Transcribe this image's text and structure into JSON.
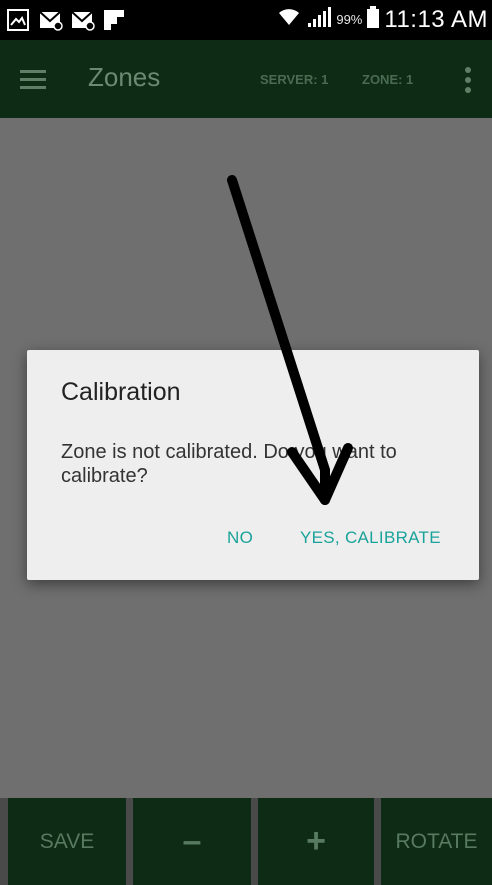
{
  "status_bar": {
    "icons_left": [
      "gallery-icon",
      "email-icon",
      "email-icon",
      "flipboard-icon"
    ],
    "icons_right": [
      "wifi-icon",
      "signal-icon",
      "battery-icon"
    ],
    "battery_percent": "99%",
    "time": "11:13 AM"
  },
  "app_bar": {
    "title": "Zones",
    "server_label": "SERVER: 1",
    "zone_label": "ZONE: 1",
    "menu_icon": "hamburger-menu-icon",
    "overflow_icon": "more-vert-icon"
  },
  "dialog": {
    "title": "Calibration",
    "message": "Zone is not calibrated. Do you want to calibrate?",
    "no_label": "NO",
    "yes_label": "YES, CALIBRATE"
  },
  "bottom_bar": {
    "save_label": "SAVE",
    "minus_label": "–",
    "plus_label": "+",
    "rotate_label": "ROTATE"
  },
  "colors": {
    "app_bar_bg": "#0d2b15",
    "status_bar_bg": "#000000",
    "content_bg": "#6f6f6f",
    "dialog_bg": "#eeeeee",
    "accent": "#1aa39a",
    "muted_green_text": "#587a60"
  },
  "annotation": {
    "type": "arrow-icon",
    "points_to": "yes-calibrate-button"
  }
}
